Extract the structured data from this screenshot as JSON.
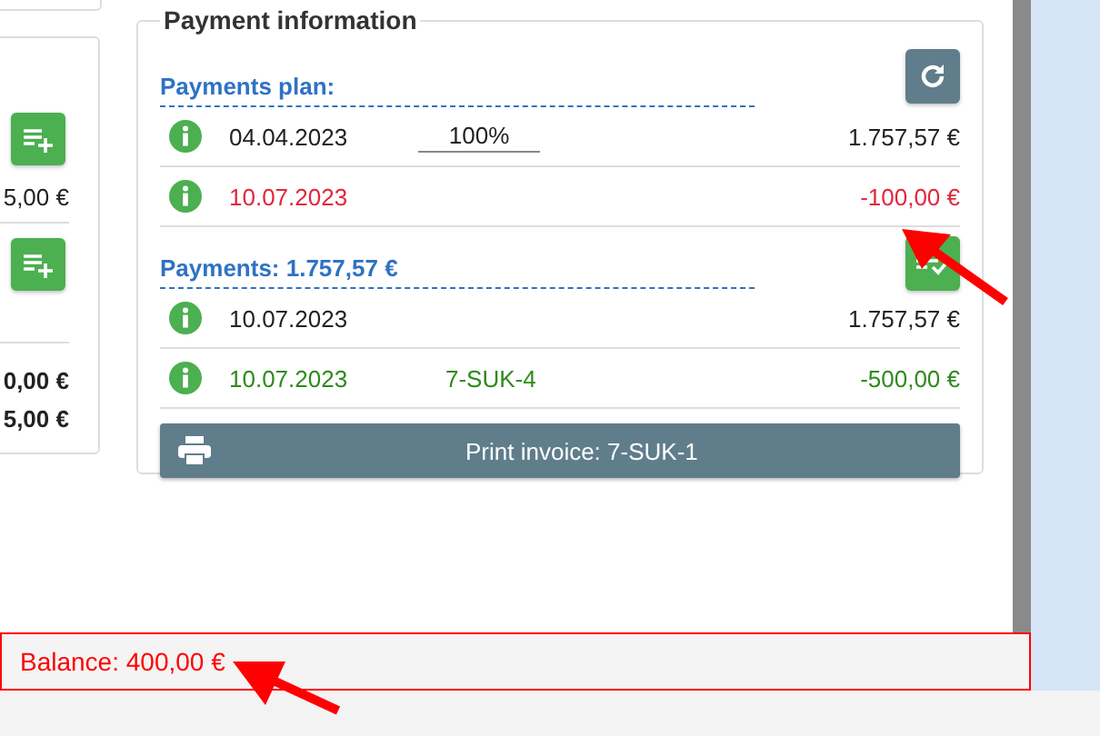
{
  "left_card": {
    "amount": "5,00 €",
    "totals": [
      "0,00 €",
      "5,00 €"
    ]
  },
  "payment_info": {
    "title": "Payment information",
    "plan": {
      "heading": "Payments plan:",
      "rows": [
        {
          "date": "04.04.2023",
          "percent": "100%",
          "amount": "1.757,57 €",
          "color": "#222222"
        },
        {
          "date": "10.07.2023",
          "amount": "-100,00 €",
          "color": "#e0283c"
        }
      ]
    },
    "payments": {
      "heading": "Payments: 1.757,57 €",
      "rows": [
        {
          "date": "10.07.2023",
          "amount": "1.757,57 €",
          "color": "#222222"
        },
        {
          "date": "10.07.2023",
          "invoice": "7-SUK-4",
          "amount": "-500,00 €",
          "color": "#2f8a1c"
        }
      ]
    },
    "print_button": "Print invoice: 7-SUK-1"
  },
  "balance": "Balance: 400,00 €"
}
